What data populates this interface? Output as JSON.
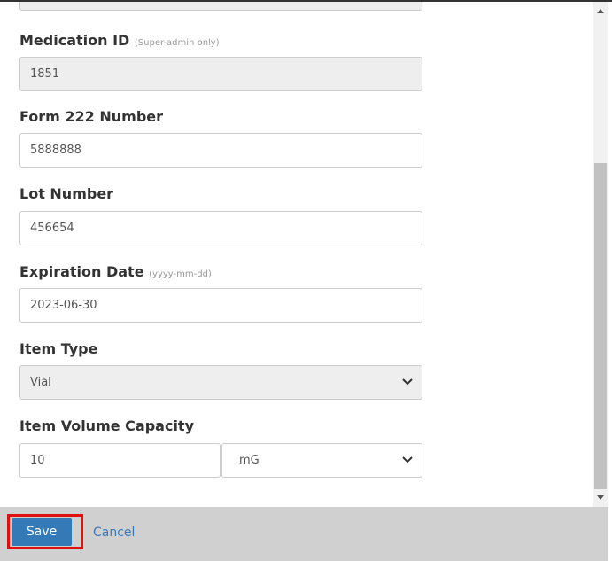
{
  "form": {
    "medication_id": {
      "label": "Medication ID",
      "hint": "(Super-admin only)",
      "value": "1851"
    },
    "form_222_number": {
      "label": "Form 222 Number",
      "value": "5888888"
    },
    "lot_number": {
      "label": "Lot Number",
      "value": "456654"
    },
    "expiration_date": {
      "label": "Expiration Date",
      "hint": "(yyyy-mm-dd)",
      "value": "2023-06-30"
    },
    "item_type": {
      "label": "Item Type",
      "value": "Vial"
    },
    "item_volume_capacity": {
      "label": "Item Volume Capacity",
      "value": "10",
      "unit": "mG"
    }
  },
  "footer": {
    "save_label": "Save",
    "cancel_label": "Cancel"
  },
  "colors": {
    "primary": "#337ab7",
    "highlight_border": "#e01010",
    "footer_bg": "#d0d0d0",
    "readonly_bg": "#eeeeee"
  }
}
